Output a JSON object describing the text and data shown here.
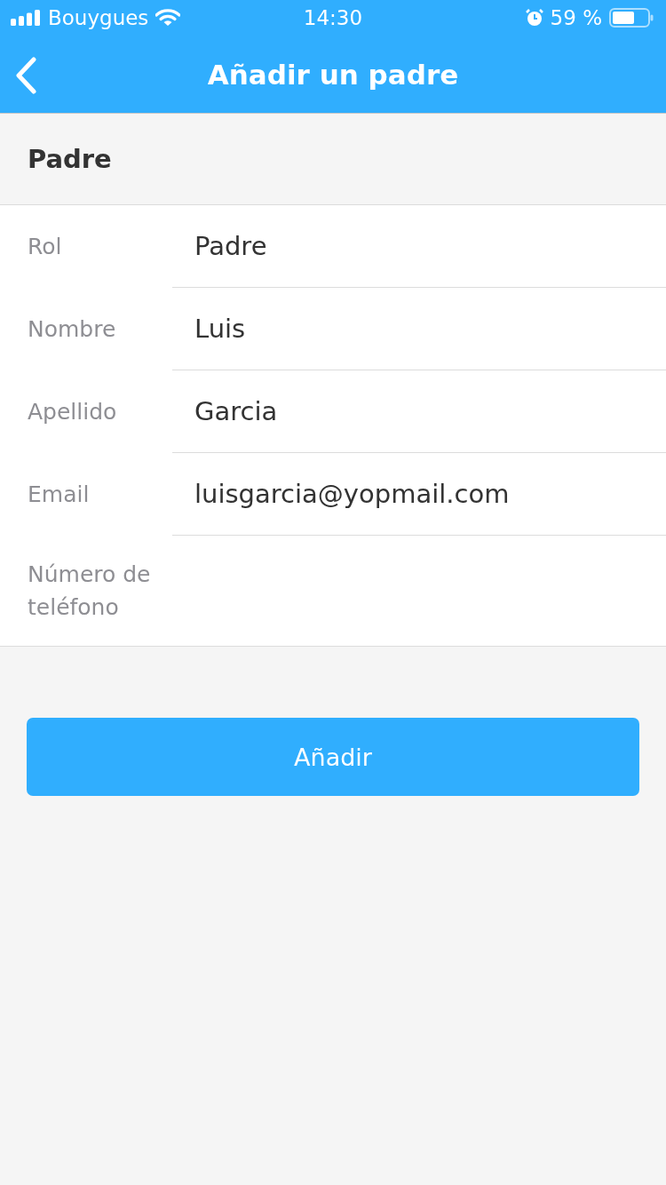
{
  "status_bar": {
    "carrier": "Bouygues",
    "time": "14:30",
    "battery": "59 %"
  },
  "nav_bar": {
    "title": "Añadir un padre"
  },
  "section": {
    "title": "Padre"
  },
  "fields": [
    {
      "label": "Rol",
      "value": "Padre"
    },
    {
      "label": "Nombre",
      "value": "Luis"
    },
    {
      "label": "Apellido",
      "value": "Garcia"
    },
    {
      "label": "Email",
      "value": "luisgarcia@yopmail.com"
    },
    {
      "label": "Número de teléfono"
    }
  ],
  "buttons": [
    "Añadir"
  ]
}
